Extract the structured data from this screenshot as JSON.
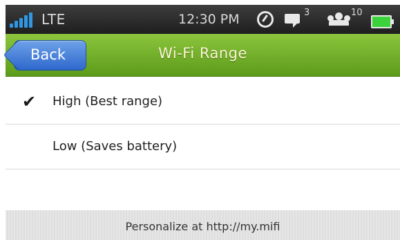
{
  "status_bar": {
    "network": "LTE",
    "time": "12:30 PM",
    "messages_count": "3",
    "users_count": "10"
  },
  "header": {
    "back_label": "Back",
    "title": "Wi-Fi Range"
  },
  "options": [
    {
      "label": "High (Best range)",
      "selected": true
    },
    {
      "label": "Low (Saves battery)",
      "selected": false
    }
  ],
  "footer": {
    "text": "Personalize at http://my.mifi"
  }
}
